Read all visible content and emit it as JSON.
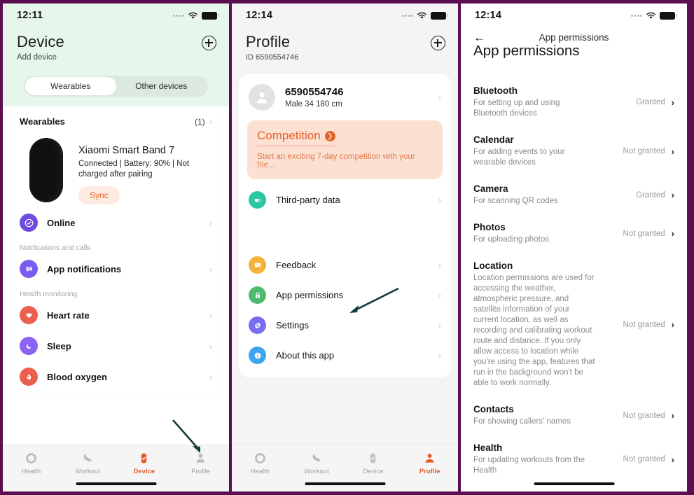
{
  "panel1": {
    "status": {
      "time": "12:11",
      "wifi_icon": "wifi-icon",
      "battery_icon": "battery-icon"
    },
    "header": {
      "title": "Device",
      "subtitle": "Add device",
      "add_icon": "plus-circle-icon"
    },
    "segmented": {
      "options": [
        "Wearables",
        "Other devices"
      ],
      "selected": "Wearables"
    },
    "section": {
      "title": "Wearables",
      "count": "(1)"
    },
    "device": {
      "name": "Xiaomi Smart Band 7",
      "status": "Connected | Battery: 90% | Not charged after pairing",
      "sync_label": "Sync"
    },
    "items": [
      {
        "label": "Online",
        "icon": "check-circle-icon",
        "color": "#6f4ce0"
      }
    ],
    "groups": [
      {
        "title": "Notifications and calls",
        "items": [
          {
            "label": "App notifications",
            "icon": "chat-bubble-icon",
            "color": "#7a5cf0"
          }
        ]
      },
      {
        "title": "Health monitoring",
        "items": [
          {
            "label": "Heart rate",
            "icon": "heart-icon",
            "color": "#ec5f4e"
          },
          {
            "label": "Sleep",
            "icon": "moon-icon",
            "color": "#8a63f2"
          },
          {
            "label": "Blood oxygen",
            "icon": "blood-drop-icon",
            "color": "#ec5f4e"
          }
        ]
      }
    ],
    "tabs": [
      {
        "label": "Health",
        "icon": "ring-icon",
        "active": false
      },
      {
        "label": "Workout",
        "icon": "shoe-icon",
        "active": false
      },
      {
        "label": "Device",
        "icon": "band-icon",
        "active": true
      },
      {
        "label": "Profile",
        "icon": "person-icon",
        "active": false
      }
    ]
  },
  "panel2": {
    "status": {
      "time": "12:14",
      "wifi_icon": "wifi-icon",
      "battery_icon": "battery-icon"
    },
    "header": {
      "title": "Profile",
      "subtitle": "ID 6590554746",
      "add_icon": "plus-circle-icon"
    },
    "profile": {
      "id": "6590554746",
      "meta": "Male 34 180 cm",
      "avatar_icon": "person-avatar-icon"
    },
    "competition": {
      "title": "Competition",
      "arrow_icon": "arrow-right-circle-icon",
      "subtitle": "Start an exciting 7-day competition with your frie..."
    },
    "items_top": [
      {
        "label": "Third-party data",
        "icon": "toggle-icon",
        "color": "#2cc6a6"
      }
    ],
    "items_bottom": [
      {
        "label": "Feedback",
        "icon": "chat-bubble-icon",
        "color": "#f5b23c"
      },
      {
        "label": "App permissions",
        "icon": "lock-icon",
        "color": "#4dbb6f"
      },
      {
        "label": "Settings",
        "icon": "gear-icon",
        "color": "#7a6ef0"
      },
      {
        "label": "About this app",
        "icon": "info-icon",
        "color": "#3da4f0"
      }
    ],
    "tabs": [
      {
        "label": "Health",
        "icon": "ring-icon",
        "active": false
      },
      {
        "label": "Workout",
        "icon": "shoe-icon",
        "active": false
      },
      {
        "label": "Device",
        "icon": "band-icon",
        "active": false
      },
      {
        "label": "Profile",
        "icon": "person-icon",
        "active": true
      }
    ]
  },
  "panel3": {
    "status": {
      "time": "12:14",
      "wifi_icon": "wifi-icon",
      "battery_icon": "battery-icon"
    },
    "nav": {
      "back_icon": "arrow-left-icon",
      "title": "App permissions"
    },
    "page_title": "App permissions",
    "permissions": [
      {
        "name": "Bluetooth",
        "desc": "For setting up and using Bluetooth devices",
        "state": "Granted"
      },
      {
        "name": "Calendar",
        "desc": "For adding events to your wearable devices",
        "state": "Not granted"
      },
      {
        "name": "Camera",
        "desc": "For scanning QR codes",
        "state": "Granted"
      },
      {
        "name": "Photos",
        "desc": "For uploading photos",
        "state": "Not granted"
      },
      {
        "name": "Location",
        "desc": "Location permissions are used for accessing the weather, atmospheric pressure, and satellite information of your current location, as well as recording and calibrating workout route and distance. If you only allow access to location while you're using the app, features that run in the background won't be able to work normally.",
        "state": "Not granted"
      },
      {
        "name": "Contacts",
        "desc": "For showing callers' names",
        "state": "Not granted"
      },
      {
        "name": "Health",
        "desc": "For updating workouts from the Health",
        "state": "Not granted"
      }
    ]
  },
  "annotations": {
    "arrow_color": "#123b3b",
    "arrow1_target": "Profile tab",
    "arrow2_target": "App permissions row"
  }
}
